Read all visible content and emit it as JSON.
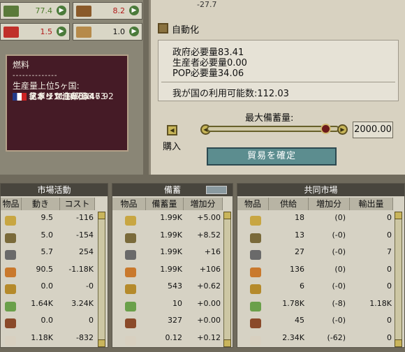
{
  "goods_panel": {
    "cells": [
      {
        "value": "77.4",
        "icon": "liquor-icon",
        "color": "#4a7a2a"
      },
      {
        "value": "8.2",
        "icon": "lumber-icon",
        "color": "#b01818"
      },
      {
        "value": "1.5",
        "icon": "explosives-icon",
        "color": "#b01818"
      },
      {
        "value": "1.0",
        "icon": "planks-icon",
        "color": "#111111"
      }
    ]
  },
  "tooltip": {
    "title": "燃料",
    "separator": "--------------",
    "heading": "生産量上位5ヶ国:",
    "rows": [
      {
        "country": "イギリス",
        "value": ":167.54"
      },
      {
        "country": "日本",
        "value": ":111.95"
      },
      {
        "country": "北ドイツ連邦",
        "value": ":68.73"
      },
      {
        "country": "アメリカ合衆国",
        "value": ":46.92"
      },
      {
        "country": "フランス",
        "value": ":11.84"
      }
    ]
  },
  "top_value": "-27.7",
  "automation_label": "自動化",
  "info": {
    "govt_need": "政府必要量83.41",
    "producer_need": "生産者必要量0.00",
    "pop_need": "POP必要量34.06",
    "available": "我が国の利用可能数:112.03"
  },
  "stockpile": {
    "label": "最大備蓄量:",
    "value": "2000.00",
    "slider_fraction": 0.93,
    "buy_label": "購入"
  },
  "confirm_button": "貿易を確定",
  "market_activity": {
    "title": "市場活動",
    "headers": [
      "物品",
      "動き",
      "コスト"
    ],
    "rows": [
      {
        "icon": "ammunition-icon",
        "move": "9.5",
        "cost": "-116"
      },
      {
        "icon": "small-arms-icon",
        "move": "5.0",
        "cost": "-154"
      },
      {
        "icon": "artillery-icon",
        "move": "5.7",
        "cost": "254"
      },
      {
        "icon": "canned-food-icon",
        "move": "90.5",
        "cost": "-1.18K"
      },
      {
        "icon": "airplanes-icon",
        "move": "0.0",
        "cost": "-0"
      },
      {
        "icon": "wheat-icon",
        "move": "1.64K",
        "cost": "3.24K"
      },
      {
        "icon": "wine-icon",
        "move": "0.0",
        "cost": "0"
      },
      {
        "icon": "cattle-icon",
        "move": "1.18K",
        "cost": "-832"
      }
    ]
  },
  "stockpile_table": {
    "title": "備蓄",
    "headers": [
      "物品",
      "備蓄量",
      "増加分"
    ],
    "rows": [
      {
        "icon": "ammunition-icon",
        "stock": "1.99K",
        "inc": "+5.00"
      },
      {
        "icon": "small-arms-icon",
        "stock": "1.99K",
        "inc": "+8.52"
      },
      {
        "icon": "artillery-icon",
        "stock": "1.99K",
        "inc": "+16"
      },
      {
        "icon": "canned-food-icon",
        "stock": "1.99K",
        "inc": "+106"
      },
      {
        "icon": "airplanes-icon",
        "stock": "543",
        "inc": "+0.62"
      },
      {
        "icon": "wheat-icon",
        "stock": "10",
        "inc": "+0.00"
      },
      {
        "icon": "wine-icon",
        "stock": "327",
        "inc": "+0.00"
      },
      {
        "icon": "cattle-icon",
        "stock": "0.12",
        "inc": "+0.12"
      }
    ]
  },
  "common_market": {
    "title": "共同市場",
    "headers": [
      "物品",
      "供給",
      "増加分",
      "輸出量"
    ],
    "rows": [
      {
        "icon": "ammunition-icon",
        "supply": "18",
        "inc": "(0)",
        "export": "0"
      },
      {
        "icon": "small-arms-icon",
        "supply": "13",
        "inc": "(-0)",
        "export": "0"
      },
      {
        "icon": "artillery-icon",
        "supply": "27",
        "inc": "(-0)",
        "export": "7"
      },
      {
        "icon": "canned-food-icon",
        "supply": "136",
        "inc": "(0)",
        "export": "0"
      },
      {
        "icon": "airplanes-icon",
        "supply": "6",
        "inc": "(-0)",
        "export": "0"
      },
      {
        "icon": "wheat-icon",
        "supply": "1.78K",
        "inc": "(-8)",
        "export": "1.18K"
      },
      {
        "icon": "wine-icon",
        "supply": "45",
        "inc": "(-0)",
        "export": "0"
      },
      {
        "icon": "cattle-icon",
        "supply": "2.34K",
        "inc": "(-62)",
        "export": "0"
      }
    ]
  }
}
